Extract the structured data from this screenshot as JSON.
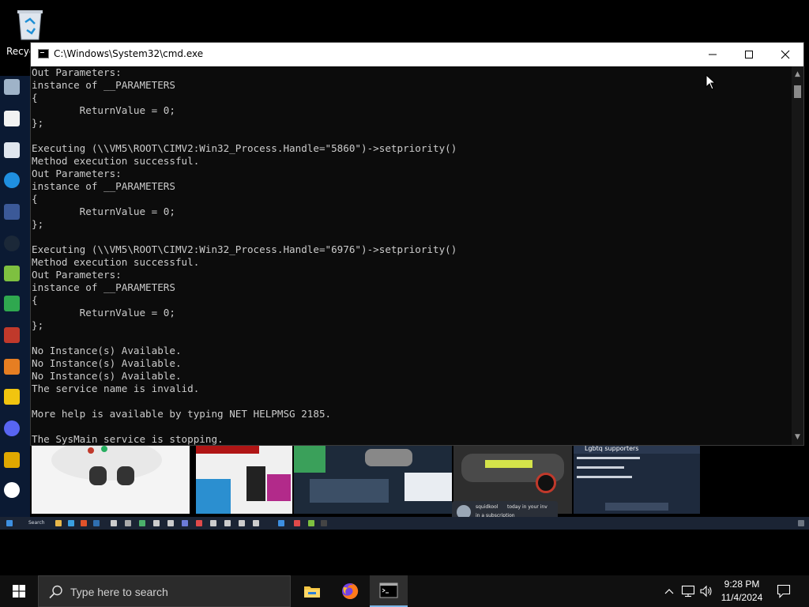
{
  "desktop": {
    "recycle_bin_label": "Recyc",
    "inner_notification": {
      "user": "squidkool",
      "text": "today in your inv",
      "text2": "in a subscription"
    },
    "stream_banner": "Lgbtq supporters"
  },
  "window": {
    "title": "C:\\Windows\\System32\\cmd.exe",
    "minimize_glyph": "—",
    "maximize_glyph": "☐",
    "close_glyph": "✕"
  },
  "console": {
    "lines": [
      "Out Parameters:",
      "instance of __PARAMETERS",
      "{",
      "        ReturnValue = 0;",
      "};",
      "",
      "Executing (\\\\VM5\\ROOT\\CIMV2:Win32_Process.Handle=\"5860\")->setpriority()",
      "Method execution successful.",
      "Out Parameters:",
      "instance of __PARAMETERS",
      "{",
      "        ReturnValue = 0;",
      "};",
      "",
      "Executing (\\\\VM5\\ROOT\\CIMV2:Win32_Process.Handle=\"6976\")->setpriority()",
      "Method execution successful.",
      "Out Parameters:",
      "instance of __PARAMETERS",
      "{",
      "        ReturnValue = 0;",
      "};",
      "",
      "No Instance(s) Available.",
      "No Instance(s) Available.",
      "No Instance(s) Available.",
      "The service name is invalid.",
      "",
      "More help is available by typing NET HELPMSG 2185.",
      "",
      "The SysMain service is stopping."
    ]
  },
  "taskbar": {
    "search_placeholder": "Type here to search",
    "clock_time": "9:28 PM",
    "clock_date": "11/4/2024"
  },
  "colors": {
    "console_bg": "#0c0c0c",
    "console_text": "#cccccc",
    "taskbar_bg": "#101010",
    "active_app_underline": "#7cb6e8"
  }
}
